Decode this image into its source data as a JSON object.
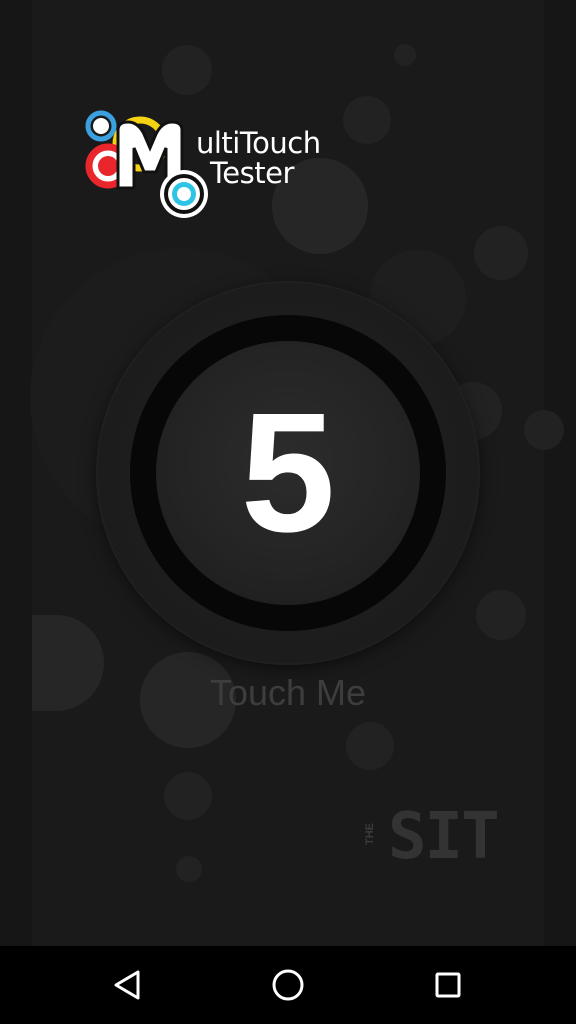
{
  "app": {
    "logo_title_line1": "ultiTouch",
    "logo_title_line2": "Tester",
    "logo_letter": "M"
  },
  "dial": {
    "touch_count": "5"
  },
  "prompt": {
    "label": "Touch Me"
  },
  "brand": {
    "prefix": "THE",
    "name": "SIT"
  },
  "navbar": {
    "back_icon": "back-triangle-icon",
    "home_icon": "home-circle-icon",
    "recent_icon": "recent-apps-square-icon"
  },
  "colors": {
    "background": "#161616",
    "logo_red": "#e8262b",
    "logo_yellow": "#f5d312",
    "logo_cyan": "#2ec4e6",
    "logo_blue": "#3aa0e0",
    "text_white": "#ffffff",
    "prompt_gray": "#3d3d3d"
  }
}
